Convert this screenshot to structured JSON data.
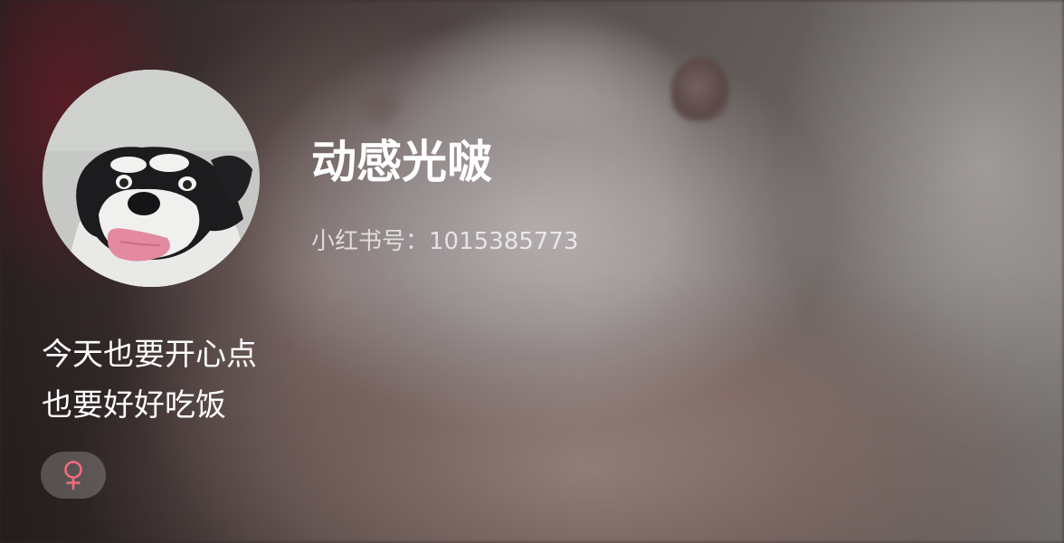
{
  "profile": {
    "nickname": "动感光啵",
    "user_id_text": "小红书号：1015385773",
    "bio_lines": [
      "今天也要开心点",
      "也要好好吃饭"
    ]
  },
  "avatar": {
    "icon": "husky-dog-avatar"
  },
  "gender": {
    "icon": "female-icon",
    "color": "#f26b7e"
  }
}
